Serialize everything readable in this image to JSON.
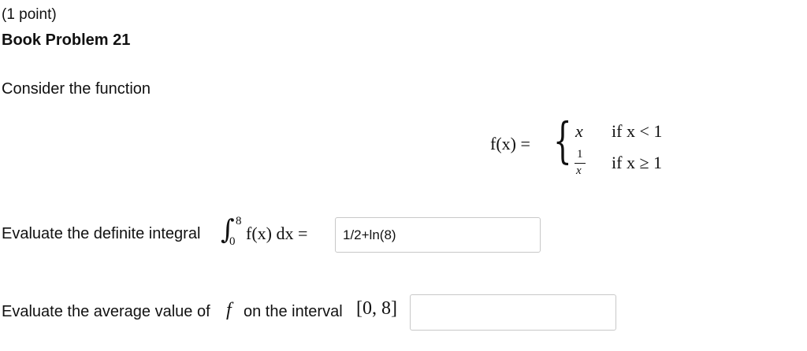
{
  "header": {
    "points": "(1 point)",
    "title": "Book Problem 21"
  },
  "problem": {
    "intro": "Consider the function",
    "function": {
      "lhs": "f(x) =",
      "case1_value": "x",
      "case1_condition": "if x < 1",
      "case2_numerator": "1",
      "case2_denominator": "x",
      "case2_condition": "if x ≥ 1"
    }
  },
  "question1": {
    "label": "Evaluate the definite integral",
    "integral_symbol": "∫",
    "upper_limit": "8",
    "lower_limit": "0",
    "integrand": "f(x) dx =",
    "answer_value": "1/2+ln(8)"
  },
  "question2": {
    "label": "Evaluate the average value of",
    "function_name": "f",
    "label_suffix": "on the interval",
    "interval": "[0, 8]",
    "answer_value": ""
  }
}
